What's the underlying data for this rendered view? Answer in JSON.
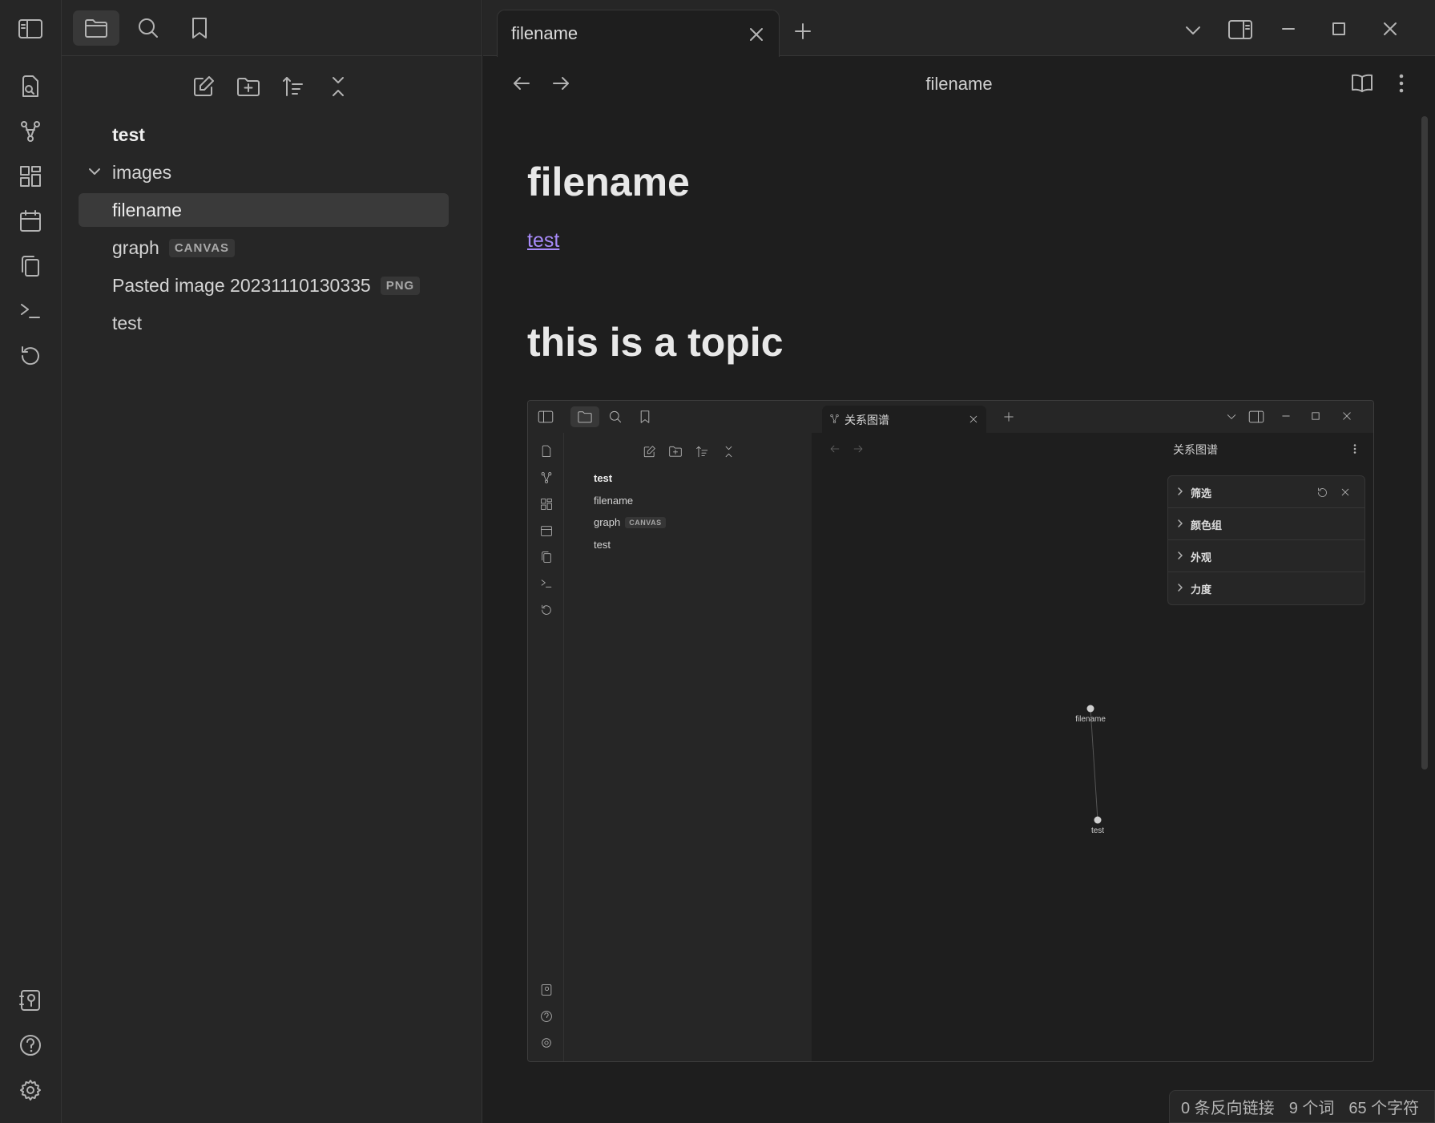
{
  "sidebar": {
    "files": [
      {
        "label": "test",
        "type": "note",
        "bold": true
      },
      {
        "label": "images",
        "type": "folder"
      },
      {
        "label": "filename",
        "type": "note",
        "active": true
      },
      {
        "label": "graph",
        "badge": "CANVAS"
      },
      {
        "label": "Pasted image 20231110130335",
        "badge": "PNG"
      },
      {
        "label": "test",
        "type": "note"
      }
    ]
  },
  "tab": {
    "title": "filename"
  },
  "view": {
    "title": "filename"
  },
  "note": {
    "heading1": "filename",
    "link": "test",
    "heading2": "this is a topic"
  },
  "status": {
    "backlinks": "0 条反向链接",
    "words": "9 个词",
    "chars": "65 个字符"
  },
  "embedded": {
    "tab_title": "关系图谱",
    "view_title": "关系图谱",
    "files": [
      {
        "label": "test",
        "bold": true
      },
      {
        "label": "filename"
      },
      {
        "label": "graph",
        "badge": "CANVAS"
      },
      {
        "label": "test"
      }
    ],
    "graph_panel": [
      "筛选",
      "颜色组",
      "外观",
      "力度"
    ],
    "graph_nodes": [
      "filename",
      "test"
    ]
  },
  "colors": {
    "background": "#1e1e1e",
    "sidebar": "#262626",
    "link": "#a88bfa",
    "active_item": "#3a3a3a"
  }
}
